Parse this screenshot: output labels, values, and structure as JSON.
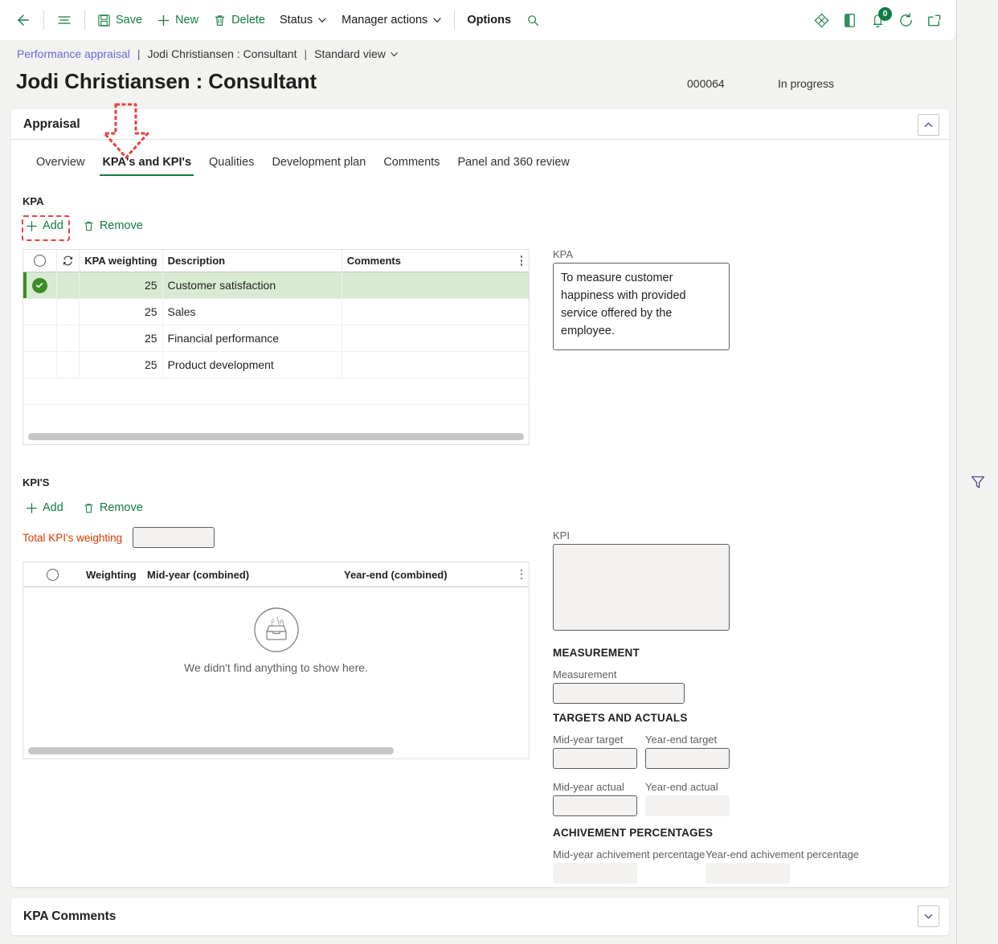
{
  "commandbar": {
    "back_label": "",
    "items": [
      {
        "name": "save",
        "label": "Save",
        "icon": "save-icon"
      },
      {
        "name": "new",
        "label": "New",
        "icon": "plus-icon"
      },
      {
        "name": "delete",
        "label": "Delete",
        "icon": "trash-icon"
      },
      {
        "name": "status",
        "label": "Status",
        "icon": "chevron-down-icon"
      },
      {
        "name": "manager-actions",
        "label": "Manager actions",
        "icon": "chevron-down-icon"
      },
      {
        "name": "options",
        "label": "Options",
        "icon": ""
      }
    ],
    "right_icons": [
      "attachments-icon",
      "office-icon",
      "notifications-icon",
      "refresh-icon",
      "open-in-new-icon"
    ],
    "notification_count": "0",
    "filter_icon": "filter-icon",
    "search_icon": "search-icon"
  },
  "breadcrumb": {
    "root": "Performance appraisal",
    "sep": "|",
    "current": "Jodi Christiansen : Consultant",
    "view": "Standard view"
  },
  "header": {
    "title": "Jodi Christiansen : Consultant",
    "record_id": "000064",
    "status": "In progress"
  },
  "appraisal": {
    "section_title": "Appraisal",
    "collapse_icon": "chevron-up-icon",
    "tabs": [
      {
        "label": "Overview",
        "active": false
      },
      {
        "label": "KPA's and KPI's",
        "active": true
      },
      {
        "label": "Qualities",
        "active": false
      },
      {
        "label": "Development plan",
        "active": false
      },
      {
        "label": "Comments",
        "active": false
      },
      {
        "label": "Panel and 360 review",
        "active": false
      }
    ]
  },
  "kpa": {
    "section_label": "KPA",
    "add_label": "Add",
    "remove_label": "Remove",
    "columns": [
      "",
      "",
      "KPA weighting",
      "Description",
      "Comments"
    ],
    "rows": [
      {
        "weighting": "25",
        "description": "Customer satisfaction",
        "comments": "",
        "selected": true
      },
      {
        "weighting": "25",
        "description": "Sales",
        "comments": "",
        "selected": false
      },
      {
        "weighting": "25",
        "description": "Financial performance",
        "comments": "",
        "selected": false
      },
      {
        "weighting": "25",
        "description": "Product development",
        "comments": "",
        "selected": false
      }
    ],
    "detail_label": "KPA",
    "detail_value": "To measure customer happiness with provided service offered by the employee."
  },
  "kpi": {
    "section_label": "KPI'S",
    "add_label": "Add",
    "remove_label": "Remove",
    "total_label": "Total KPI's weighting",
    "total_value": "",
    "columns": [
      "",
      "Weighting",
      "Mid-year (combined)",
      "Year-end (combined)"
    ],
    "empty_message": "We didn't find anything to show here.",
    "empty_icon": "empty-box-icon",
    "detail_label": "KPI",
    "detail_value": "",
    "measurement_group": "MEASUREMENT",
    "measurement_label": "Measurement",
    "measurement_value": "",
    "targets_group": "TARGETS AND ACTUALS",
    "midyear_target_label": "Mid-year target",
    "midyear_target_value": "",
    "yearend_target_label": "Year-end target",
    "yearend_target_value": "",
    "midyear_actual_label": "Mid-year actual",
    "midyear_actual_value": "",
    "yearend_actual_label": "Year-end actual",
    "yearend_actual_value": "",
    "achievement_group": "ACHIVEMENT PERCENTAGES",
    "midyear_pct_label": "Mid-year achivement percentage",
    "midyear_pct_value": "",
    "yearend_pct_label": "Year-end achivement percentage",
    "yearend_pct_value": ""
  },
  "kpa_comments": {
    "section_title": "KPA Comments",
    "expand_icon": "chevron-down-icon"
  },
  "colors": {
    "accent_green": "#107c41",
    "selected_row": "#d9ead3",
    "annotation_red": "#e8433f",
    "link_purple": "#6b69d6",
    "warning_orange": "#d83b01"
  }
}
